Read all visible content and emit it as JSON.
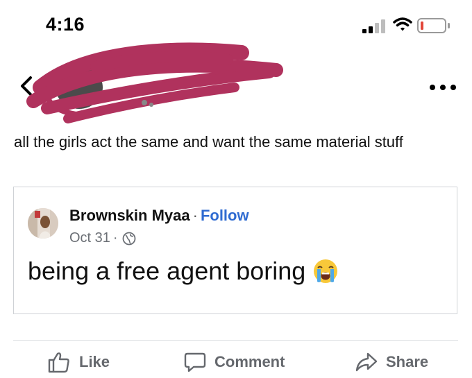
{
  "status_bar": {
    "time": "4:16"
  },
  "post": {
    "text": "all the girls act the same and want the same material stuff"
  },
  "shared_post": {
    "author": "Brownskin Myaa",
    "separator": "·",
    "follow_label": "Follow",
    "date": "Oct 31",
    "body": "being a free agent boring"
  },
  "actions": {
    "like_label": "Like",
    "comment_label": "Comment",
    "share_label": "Share"
  },
  "colors": {
    "link_blue": "#2f6bd1",
    "scribble": "#b0325d",
    "action_gray": "#65686d",
    "battery_red": "#e2463a"
  }
}
